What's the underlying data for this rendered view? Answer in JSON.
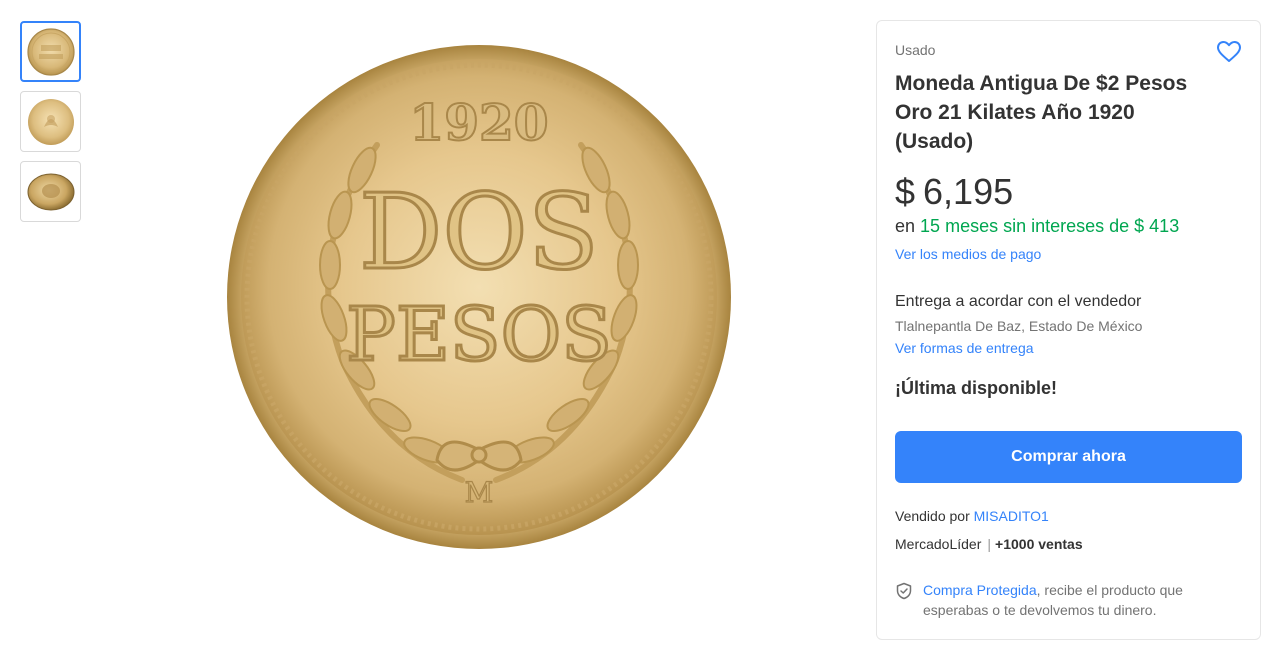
{
  "gallery": {
    "thumbnails": [
      {
        "alt": "1920 DOS PESOS reverse"
      },
      {
        "alt": "obverse eagle"
      },
      {
        "alt": "coin angled"
      }
    ],
    "main_image": {
      "year": "1920",
      "denomination_line1": "DOS",
      "denomination_line2": "PESOS",
      "mint_mark": "M"
    }
  },
  "product": {
    "condition": "Usado",
    "title": "Moneda Antigua De $2 Pesos Oro 21 Kilates Año 1920 (Usado)",
    "currency": "$",
    "price": "6,195",
    "installments_prefix": "en",
    "installments_highlight": "15 meses sin intereses de $ 413",
    "payment_link": "Ver los medios de pago"
  },
  "delivery": {
    "title": "Entrega a acordar con el vendedor",
    "location": "Tlalnepantla De Baz, Estado De México",
    "link": "Ver formas de entrega"
  },
  "stock": {
    "label": "¡Última disponible!"
  },
  "actions": {
    "buy_label": "Comprar ahora"
  },
  "seller": {
    "prefix": "Vendido por",
    "name": "MISADITO1",
    "badge": "MercadoLíder",
    "separator": "|",
    "sales": "+1000 ventas"
  },
  "protection": {
    "link": "Compra Protegida",
    "text": ", recibe el producto que esperabas o te devolvemos tu dinero."
  },
  "colors": {
    "accent": "#3483fa",
    "green": "#00a650",
    "gold": "#d9b977"
  }
}
